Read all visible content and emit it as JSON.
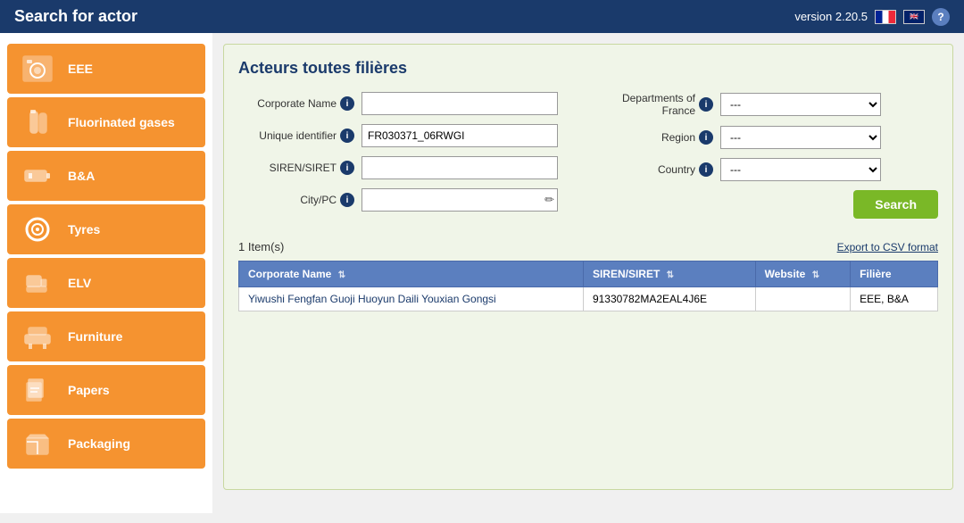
{
  "app": {
    "version": "version 2.20.5",
    "title": "Search for actor"
  },
  "sidebar": {
    "items": [
      {
        "id": "eee",
        "label": "EEE",
        "icon": "washing-machine"
      },
      {
        "id": "fluorinated-gases",
        "label": "Fluorinated gases",
        "icon": "gas-cylinder"
      },
      {
        "id": "bna",
        "label": "B&A",
        "icon": "battery"
      },
      {
        "id": "tyres",
        "label": "Tyres",
        "icon": "tyre"
      },
      {
        "id": "elv",
        "label": "ELV",
        "icon": "car-seat"
      },
      {
        "id": "furniture",
        "label": "Furniture",
        "icon": "furniture"
      },
      {
        "id": "papers",
        "label": "Papers",
        "icon": "papers"
      },
      {
        "id": "packaging",
        "label": "Packaging",
        "icon": "packaging"
      }
    ]
  },
  "panel": {
    "title": "Acteurs toutes filières",
    "form": {
      "corporate_name_label": "Corporate Name",
      "unique_id_label": "Unique identifier",
      "siren_label": "SIREN/SIRET",
      "city_label": "City/PC",
      "departments_label": "Departments of France",
      "region_label": "Region",
      "country_label": "Country",
      "corporate_name_value": "",
      "unique_id_value": "FR030371_06RWGI",
      "siren_value": "",
      "city_value": "",
      "departments_value": "---",
      "region_value": "---",
      "country_value": "---",
      "departments_options": [
        "---"
      ],
      "region_options": [
        "---"
      ],
      "country_options": [
        "---"
      ]
    },
    "search_button": "Search",
    "export_label": "Export to CSV format",
    "results_count": "1 Item(s)",
    "table": {
      "headers": [
        "Corporate Name",
        "SIREN/SIRET",
        "Website",
        "Filière"
      ],
      "rows": [
        {
          "corporate_name": "Yiwushi Fengfan Guoji Huoyun Daili Youxian Gongsi",
          "siren": "91330782MA2EAL4J6E",
          "website": "",
          "filiere": "EEE, B&A"
        }
      ]
    }
  },
  "flags": {
    "fr_label": "French",
    "uk_label": "English"
  },
  "help_label": "?"
}
